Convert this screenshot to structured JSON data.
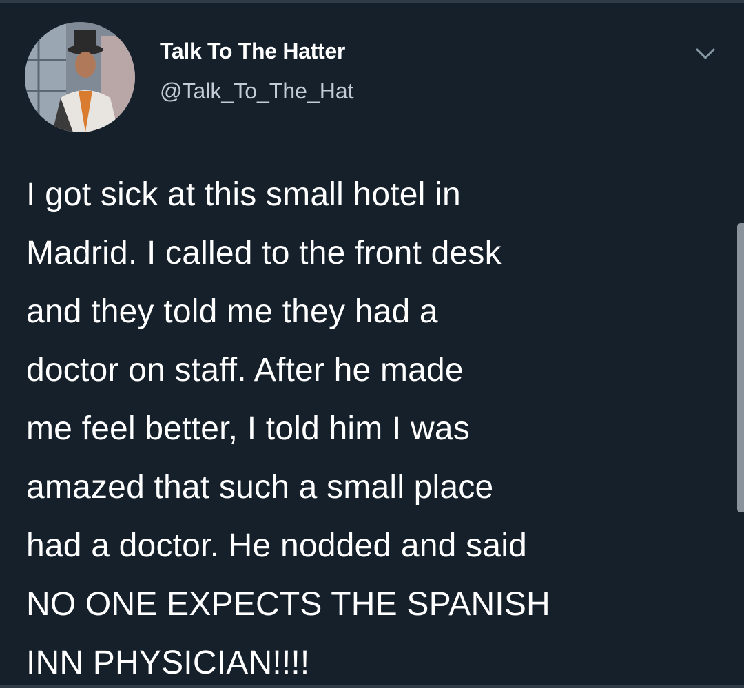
{
  "tweet": {
    "author": {
      "display_name": "Talk To The Hatter",
      "handle": "@Talk_To_The_Hat",
      "avatar_icon": "avatar-photo"
    },
    "menu_icon": "chevron-down-icon",
    "text_lines": [
      "I got sick at this small hotel in",
      "Madrid. I called to the front desk",
      "and they told me they had a",
      "doctor on staff. After he made",
      "me feel better, I told him I was",
      "amazed that such a small place",
      "had a doctor. He nodded and said",
      "NO ONE EXPECTS THE SPANISH",
      "INN PHYSICIAN!!!!"
    ]
  },
  "colors": {
    "background": "#15202b",
    "text": "#ffffff",
    "secondary_text": "#c3ccd5"
  }
}
